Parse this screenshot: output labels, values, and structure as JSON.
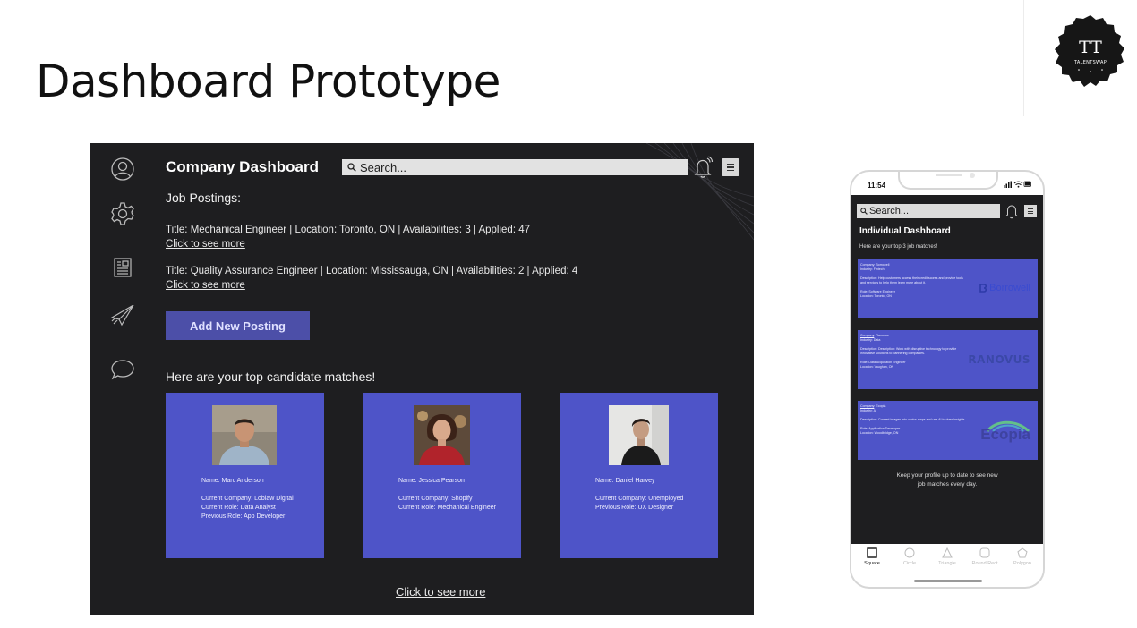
{
  "slide": {
    "title": "Dashboard Prototype",
    "logo": {
      "initials": "TT",
      "name": "TALENTSWAP"
    }
  },
  "company_dashboard": {
    "title": "Company Dashboard",
    "search_placeholder": "Search...",
    "sidebar_icons": [
      "profile-icon",
      "settings-icon",
      "document-icon",
      "send-icon",
      "chat-icon"
    ],
    "job_postings_heading": "Job Postings:",
    "postings": [
      {
        "summary": "Title: Mechanical Engineer  |  Location: Toronto, ON  |  Availabilities: 3  | Applied: 47",
        "link": "Click to see more"
      },
      {
        "summary": "Title: Quality Assurance Engineer  |  Location: Mississauga, ON  |  Availabilities: 2  | Applied: 4",
        "link": "Click to see more"
      }
    ],
    "add_button": "Add New Posting",
    "matches_heading": "Here are your top candidate matches!",
    "candidates": [
      {
        "name": "Name: Marc Anderson",
        "lines": [
          "Current Company: Loblaw Digital",
          "Current Role: Data Analyst",
          "Previous Role: App Developer"
        ]
      },
      {
        "name": "Name: Jessica Pearson",
        "lines": [
          "Current Company: Shopify",
          "Current Role: Mechanical Engineer"
        ]
      },
      {
        "name": "Name: Daniel Harvey",
        "lines": [
          "Current Company: Unemployed",
          "Previous Role: UX Designer"
        ]
      }
    ],
    "see_more": "Click to see more",
    "colors": {
      "background": "#1e1e20",
      "card": "#4e54c8",
      "button": "#4c4fa8"
    }
  },
  "phone": {
    "time": "11:54",
    "search_placeholder": "Search...",
    "title": "Individual Dashboard",
    "subtitle": "Here are your top 3 job matches!",
    "jobs": [
      {
        "company_label": "Company",
        "company": ": Borrowell",
        "industry": "Industry: Fintech",
        "description": "Description: Help customers access their credit scores and provide tools and services to help them learn more about it.",
        "role": "Role: Software Engineer",
        "location": "Location: Toronto, ON",
        "logo_text": "Borrowell"
      },
      {
        "company_label": "Company",
        "company": ": Ranovus",
        "industry": "Industry: Data",
        "description": "Description: Description: Work with disruptive technology to provide innovative solutions to partnering companies.",
        "role": "Role: Data Acquisition Engineer",
        "location": "Location: Vaughan, ON",
        "logo_text": "RANOVUS"
      },
      {
        "company_label": "Company",
        "company": ": Ecopia",
        "industry": "Industry: AI",
        "description": "Description: Convert images into vector maps and use AI to draw insights.",
        "role": "Role: Application Developer",
        "location": "Location: Woodbridge, ON",
        "logo_text": "Ecopia"
      }
    ],
    "footer": [
      "Keep your profile up to date to see new",
      "job matches every day."
    ],
    "tabs": [
      "Square",
      "Circle",
      "Triangle",
      "Round Rect",
      "Polygon"
    ],
    "active_tab": "Square"
  }
}
